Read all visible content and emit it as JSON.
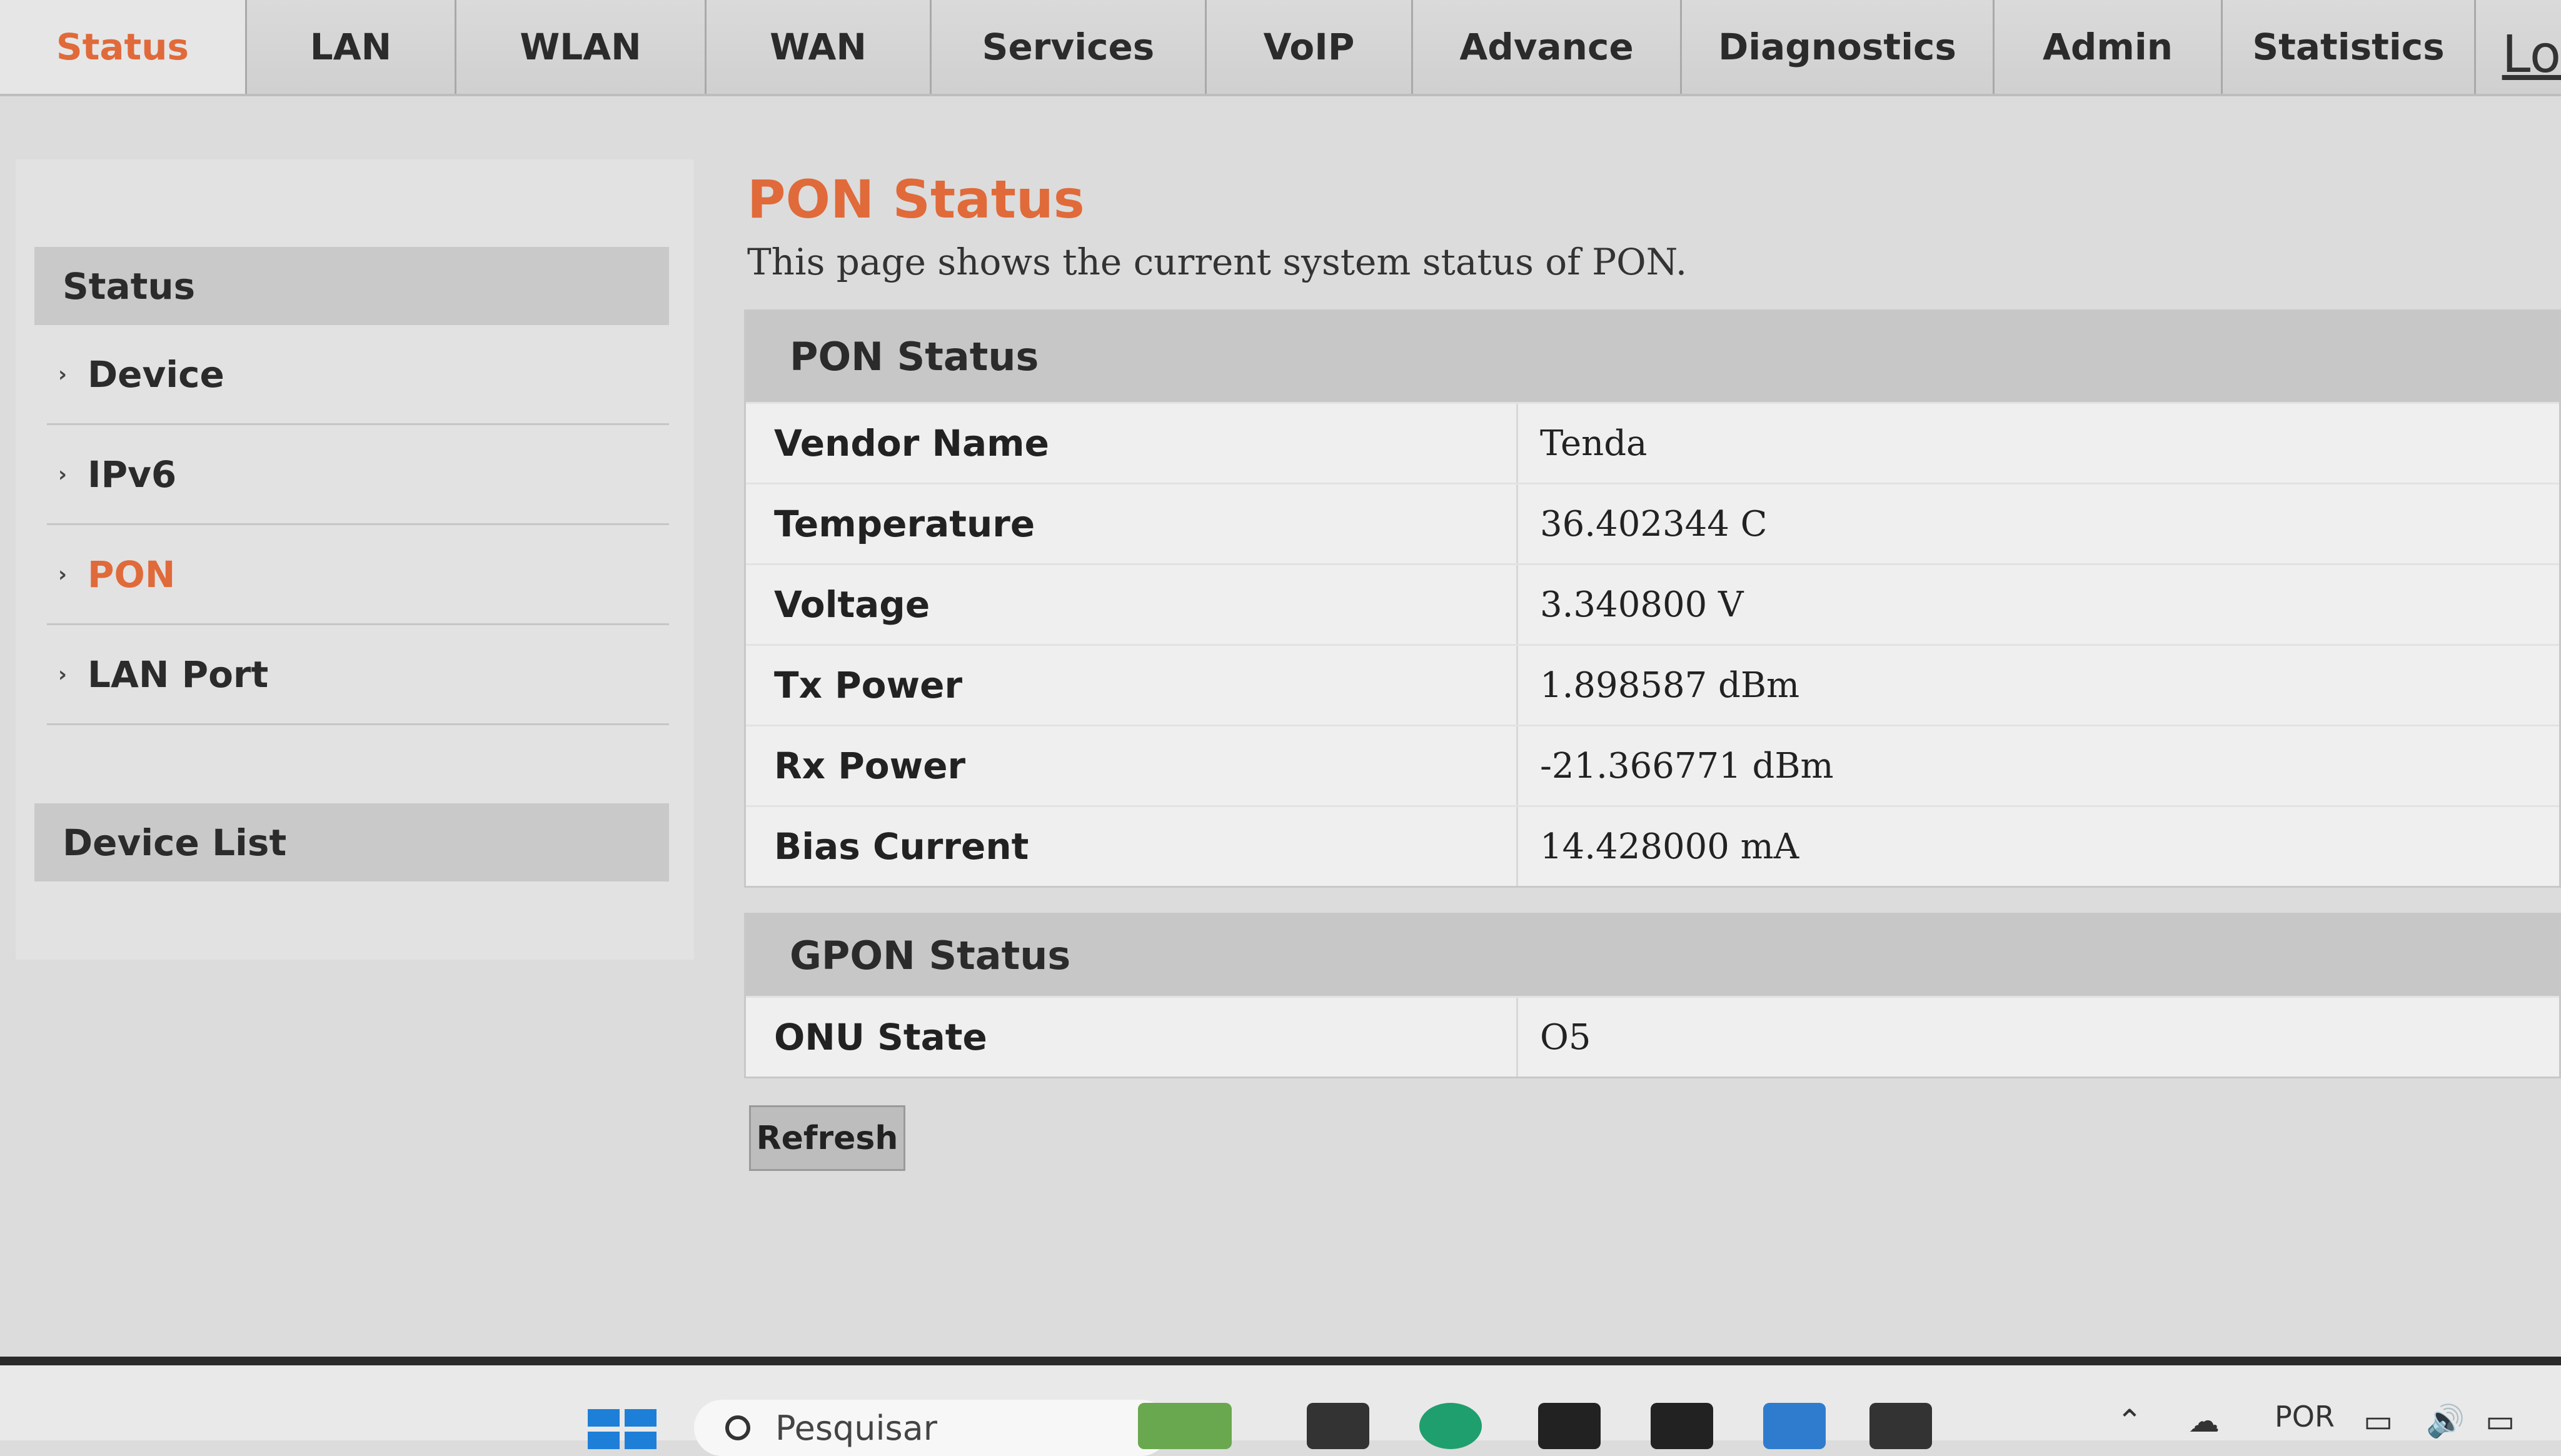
{
  "nav": {
    "tabs": [
      {
        "label": "Status",
        "active": true
      },
      {
        "label": "LAN"
      },
      {
        "label": "WLAN"
      },
      {
        "label": "WAN"
      },
      {
        "label": "Services"
      },
      {
        "label": "VoIP"
      },
      {
        "label": "Advance"
      },
      {
        "label": "Diagnostics"
      },
      {
        "label": "Admin"
      },
      {
        "label": "Statistics"
      }
    ],
    "logout_partial": "Lo"
  },
  "sidebar": {
    "header": "Status",
    "items": [
      {
        "label": "Device"
      },
      {
        "label": "IPv6"
      },
      {
        "label": "PON",
        "active": true
      },
      {
        "label": "LAN Port"
      }
    ],
    "device_list": "Device List"
  },
  "main": {
    "title": "PON Status",
    "description": "This page shows the current system status of PON.",
    "pon_panel": {
      "header": "PON Status",
      "rows": [
        {
          "label": "Vendor Name",
          "value": "Tenda"
        },
        {
          "label": "Temperature",
          "value": "36.402344 C"
        },
        {
          "label": "Voltage",
          "value": "3.340800 V"
        },
        {
          "label": "Tx Power",
          "value": "1.898587 dBm"
        },
        {
          "label": "Rx Power",
          "value": "-21.366771 dBm"
        },
        {
          "label": "Bias Current",
          "value": "14.428000 mA"
        }
      ]
    },
    "gpon_panel": {
      "header": "GPON Status",
      "rows": [
        {
          "label": "ONU State",
          "value": "O5"
        }
      ]
    },
    "refresh_label": "Refresh"
  },
  "taskbar": {
    "search_placeholder": "Pesquisar",
    "language": "POR"
  },
  "colors": {
    "accent": "#e06a3a",
    "panel_header": "#c7c7c7",
    "background": "#dcdcdc"
  }
}
